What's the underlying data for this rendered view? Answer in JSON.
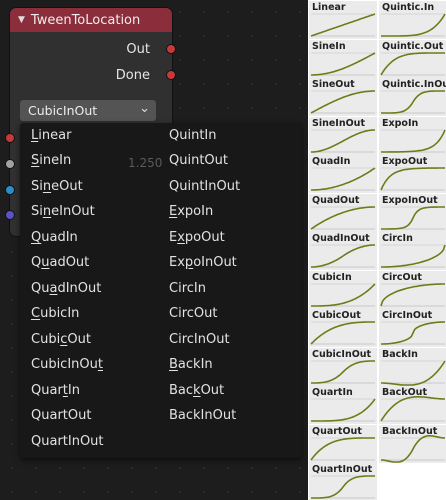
{
  "node": {
    "title": "TweenToLocation",
    "outputs": [
      "Out",
      "Done"
    ],
    "selected_easing": "CubicInOut"
  },
  "ghost": {
    "value": "1.250"
  },
  "menu": {
    "left": [
      "Linear",
      "SineIn",
      "SineOut",
      "SineInOut",
      "QuadIn",
      "QuadOut",
      "QuadInOut",
      "CubicIn",
      "CubicOut",
      "CubicInOut",
      "QuartIn",
      "QuartOut",
      "QuartInOut"
    ],
    "right": [
      "QuintIn",
      "QuintOut",
      "QuintInOut",
      "ExpoIn",
      "ExpoOut",
      "ExpoInOut",
      "CircIn",
      "CircOut",
      "CircInOut",
      "BackIn",
      "BackOut",
      "BackInOut"
    ]
  },
  "reference": {
    "left": [
      "Linear",
      "SineIn",
      "SineOut",
      "SineInOut",
      "QuadIn",
      "QuadOut",
      "QuadInOut",
      "CubicIn",
      "CubicOut",
      "CubicInOut",
      "QuartIn",
      "QuartOut",
      "QuartInOut"
    ],
    "right": [
      "Quintic.In",
      "Quintic.Out",
      "Quintic.InOut",
      "ExpoIn",
      "ExpoOut",
      "ExpoInOut",
      "CircIn",
      "CircOut",
      "CircInOut",
      "BackIn",
      "BackOut",
      "BackInOut"
    ],
    "curve_color": "#6b7d18"
  },
  "colors": {
    "node_header": "#8c2d3b",
    "socket_red": "#c73a3a",
    "socket_gray": "#a1a1a1",
    "socket_blue": "#2a8fc9",
    "socket_purple": "#5b52c7"
  }
}
